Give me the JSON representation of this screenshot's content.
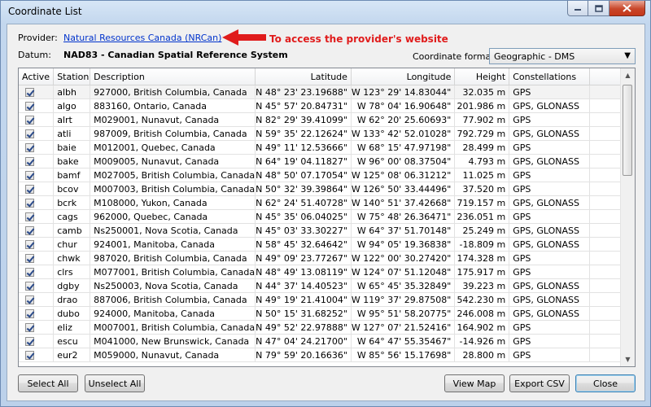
{
  "window": {
    "title": "Coordinate List"
  },
  "provider": {
    "label": "Provider:",
    "link_text": "Natural Resources Canada (NRCan)"
  },
  "annotation": {
    "text": "To access the provider's website",
    "color": "#e01c1c"
  },
  "datum": {
    "label": "Datum:",
    "value": "NAD83 - Canadian Spatial Reference System"
  },
  "coord_format": {
    "label": "Coordinate format:",
    "value": "Geographic - DMS"
  },
  "table": {
    "headers": [
      "Active",
      "Station",
      "Description",
      "Latitude",
      "Longitude",
      "Height",
      "Constellations"
    ],
    "rows": [
      {
        "station": "albh",
        "description": "927000, British Columbia, Canada",
        "lat": "N 48° 23' 23.19688\"",
        "lon": "W 123° 29' 14.83044\"",
        "height": "32.035 m",
        "const": "GPS"
      },
      {
        "station": "algo",
        "description": "883160, Ontario, Canada",
        "lat": "N 45° 57' 20.84731\"",
        "lon": "W 78° 04' 16.90648\"",
        "height": "201.986 m",
        "const": "GPS, GLONASS"
      },
      {
        "station": "alrt",
        "description": "M029001, Nunavut, Canada",
        "lat": "N 82° 29' 39.41099\"",
        "lon": "W 62° 20' 25.60693\"",
        "height": "77.902 m",
        "const": "GPS"
      },
      {
        "station": "atli",
        "description": "987009, British Columbia, Canada",
        "lat": "N 59° 35' 22.12624\"",
        "lon": "W 133° 42' 52.01028\"",
        "height": "792.729 m",
        "const": "GPS, GLONASS"
      },
      {
        "station": "baie",
        "description": "M012001, Quebec, Canada",
        "lat": "N 49° 11' 12.53666\"",
        "lon": "W 68° 15' 47.97198\"",
        "height": "28.499 m",
        "const": "GPS"
      },
      {
        "station": "bake",
        "description": "M009005, Nunavut, Canada",
        "lat": "N 64° 19' 04.11827\"",
        "lon": "W 96° 00' 08.37504\"",
        "height": "4.793 m",
        "const": "GPS, GLONASS"
      },
      {
        "station": "bamf",
        "description": "M027005, British Columbia, Canada",
        "lat": "N 48° 50' 07.17054\"",
        "lon": "W 125° 08' 06.31212\"",
        "height": "11.025 m",
        "const": "GPS"
      },
      {
        "station": "bcov",
        "description": "M007003, British Columbia, Canada",
        "lat": "N 50° 32' 39.39864\"",
        "lon": "W 126° 50' 33.44496\"",
        "height": "37.520 m",
        "const": "GPS"
      },
      {
        "station": "bcrk",
        "description": "M108000, Yukon, Canada",
        "lat": "N 62° 24' 51.40728\"",
        "lon": "W 140° 51' 37.42668\"",
        "height": "719.157 m",
        "const": "GPS, GLONASS"
      },
      {
        "station": "cags",
        "description": "962000, Quebec, Canada",
        "lat": "N 45° 35' 06.04025\"",
        "lon": "W 75° 48' 26.36471\"",
        "height": "236.051 m",
        "const": "GPS"
      },
      {
        "station": "camb",
        "description": "Ns250001, Nova Scotia, Canada",
        "lat": "N 45° 03' 33.30227\"",
        "lon": "W 64° 37' 51.70148\"",
        "height": "25.249 m",
        "const": "GPS, GLONASS"
      },
      {
        "station": "chur",
        "description": "924001, Manitoba, Canada",
        "lat": "N 58° 45' 32.64642\"",
        "lon": "W 94° 05' 19.36838\"",
        "height": "-18.809 m",
        "const": "GPS, GLONASS"
      },
      {
        "station": "chwk",
        "description": "987020, British Columbia, Canada",
        "lat": "N 49° 09' 23.77267\"",
        "lon": "W 122° 00' 30.27420\"",
        "height": "174.328 m",
        "const": "GPS"
      },
      {
        "station": "clrs",
        "description": "M077001, British Columbia, Canada",
        "lat": "N 48° 49' 13.08119\"",
        "lon": "W 124° 07' 51.12048\"",
        "height": "175.917 m",
        "const": "GPS"
      },
      {
        "station": "dgby",
        "description": "Ns250003, Nova Scotia, Canada",
        "lat": "N 44° 37' 14.40523\"",
        "lon": "W 65° 45' 35.32849\"",
        "height": "39.223 m",
        "const": "GPS, GLONASS"
      },
      {
        "station": "drao",
        "description": "887006, British Columbia, Canada",
        "lat": "N 49° 19' 21.41004\"",
        "lon": "W 119° 37' 29.87508\"",
        "height": "542.230 m",
        "const": "GPS, GLONASS"
      },
      {
        "station": "dubo",
        "description": "924000, Manitoba, Canada",
        "lat": "N 50° 15' 31.68252\"",
        "lon": "W 95° 51' 58.20775\"",
        "height": "246.008 m",
        "const": "GPS, GLONASS"
      },
      {
        "station": "eliz",
        "description": "M007001, British Columbia, Canada",
        "lat": "N 49° 52' 22.97888\"",
        "lon": "W 127° 07' 21.52416\"",
        "height": "164.902 m",
        "const": "GPS"
      },
      {
        "station": "escu",
        "description": "M041000, New Brunswick, Canada",
        "lat": "N 47° 04' 24.21700\"",
        "lon": "W 64° 47' 55.35467\"",
        "height": "-14.926 m",
        "const": "GPS"
      },
      {
        "station": "eur2",
        "description": "M059000, Nunavut, Canada",
        "lat": "N 79° 59' 20.16636\"",
        "lon": "W 85° 56' 15.17698\"",
        "height": "28.800 m",
        "const": "GPS"
      }
    ]
  },
  "buttons": {
    "select_all": "Select All",
    "unselect_all": "Unselect All",
    "view_map": "View Map",
    "export_csv": "Export CSV",
    "close": "Close"
  },
  "icons": {
    "minimize": "minimize-icon",
    "maximize": "maximize-icon",
    "close": "close-icon",
    "arrow": "left-arrow-icon",
    "dropdown": "chevron-down-icon",
    "checkbox": "checkbox-checked-icon"
  }
}
